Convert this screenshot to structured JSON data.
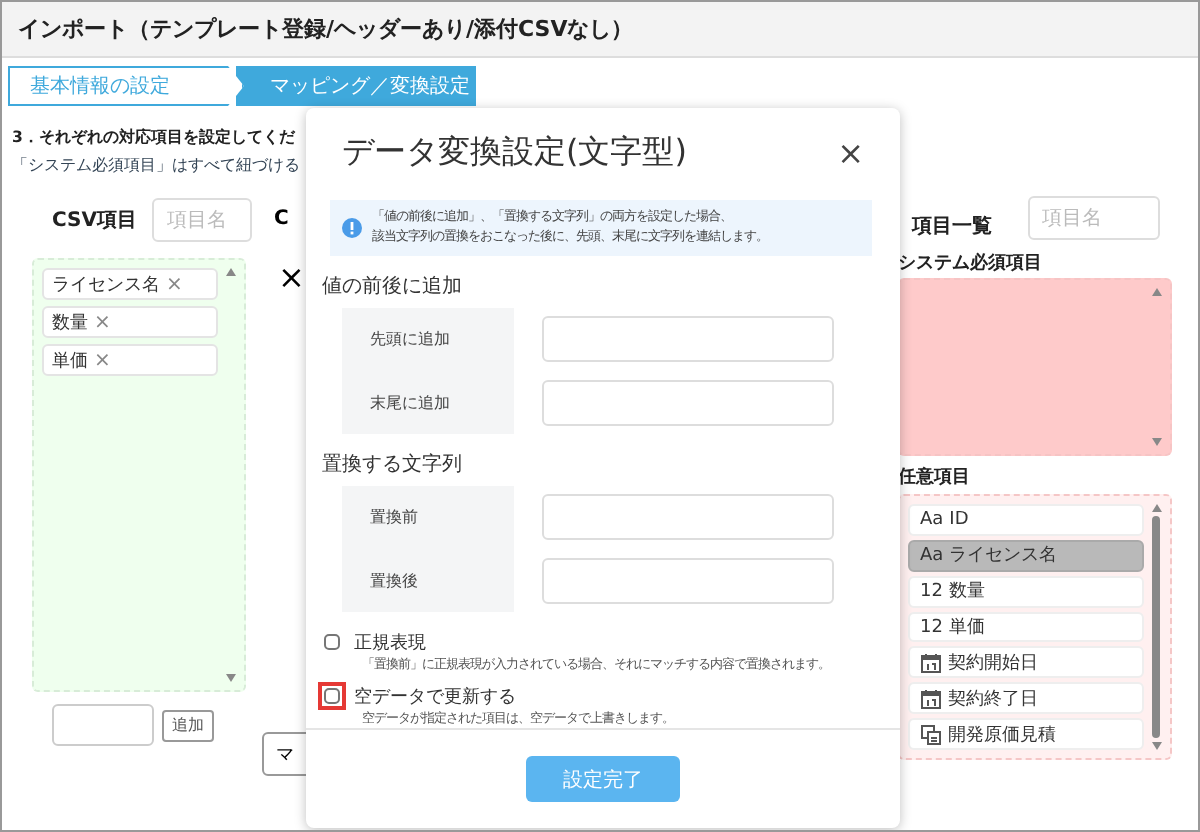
{
  "window": {
    "title": "インポート（テンプレート登録/ヘッダーあり/添付CSVなし）"
  },
  "steps": [
    {
      "label": "基本情報の設定",
      "selected": false
    },
    {
      "label": "マッピング／変換設定",
      "selected": true
    }
  ],
  "instructions": {
    "heading": "3．それぞれの対応項目を設定してくだ",
    "note": "「システム必須項目」はすべて紐づける"
  },
  "csv_panel": {
    "label": "CSV項目",
    "search": {
      "placeholder": "項目名"
    },
    "items": [
      {
        "label": "ライセンス名",
        "remove": "×"
      },
      {
        "label": "数量",
        "remove": "×"
      },
      {
        "label": "単価",
        "remove": "×"
      }
    ],
    "add_button": "追加"
  },
  "middle": {
    "column_label": "C",
    "clear": "×",
    "button": "マ"
  },
  "field_panel": {
    "label": "項目一覧",
    "search": {
      "placeholder": "項目名"
    },
    "required_heading": "システム必須項目",
    "optional_heading": "任意項目",
    "optional_items": [
      {
        "kind": "text",
        "badge": "Aa",
        "label": "ID",
        "selected": false
      },
      {
        "kind": "text",
        "badge": "Aa",
        "label": "ライセンス名",
        "selected": true
      },
      {
        "kind": "number",
        "badge": "12",
        "label": "数量",
        "selected": false
      },
      {
        "kind": "number",
        "badge": "12",
        "label": "単価",
        "selected": false
      },
      {
        "kind": "date",
        "label": "契約開始日",
        "selected": false
      },
      {
        "kind": "date",
        "label": "契約終了日",
        "selected": false
      },
      {
        "kind": "lookup",
        "label": "開発原価見積",
        "selected": false
      }
    ]
  },
  "dialog": {
    "title": "データ変換設定(文字型)",
    "close": "×",
    "info_lines": [
      "「値の前後に追加」、「置換する文字列」の両方を設定した場合、",
      "該当文字列の置換をおこなった後に、先頭、末尾に文字列を連結します。"
    ],
    "sections": [
      {
        "heading": "値の前後に追加",
        "fields": [
          {
            "label": "先頭に追加"
          },
          {
            "label": "末尾に追加"
          }
        ]
      },
      {
        "heading": "置換する文字列",
        "fields": [
          {
            "label": "置換前"
          },
          {
            "label": "置換後"
          }
        ]
      }
    ],
    "options": [
      {
        "label": "正規表現",
        "description": "「置換前」に正規表現が入力されている場合、それにマッチする内容で置換されます。",
        "checked": false,
        "highlighted": false
      },
      {
        "label": "空データで更新する",
        "description": "空データが指定された項目は、空データで上書きします。",
        "checked": false,
        "highlighted": true
      }
    ],
    "submit": "設定完了"
  }
}
